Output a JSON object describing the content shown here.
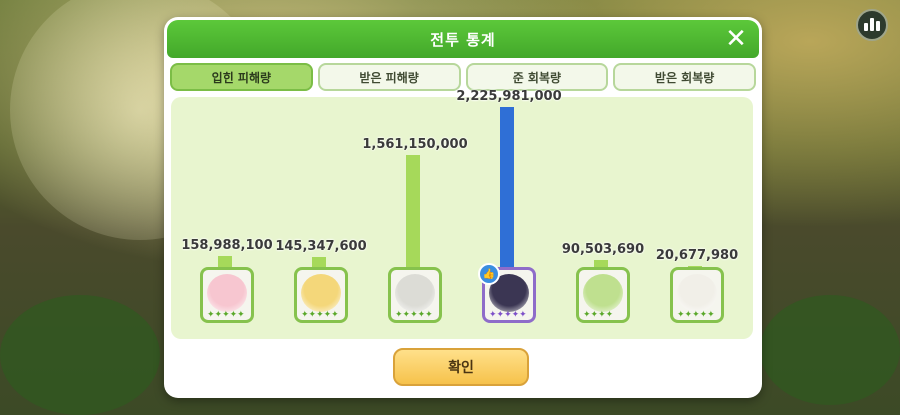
{
  "modal": {
    "title": "전투 통계",
    "close_glyph": "✕",
    "confirm_label": "확인"
  },
  "tabs": [
    {
      "label": "입힌 피해량",
      "active": true
    },
    {
      "label": "받은 피해량",
      "active": false
    },
    {
      "label": "준 회복량",
      "active": false
    },
    {
      "label": "받은 회복량",
      "active": false
    }
  ],
  "chart_data": {
    "type": "bar",
    "categories": [
      "",
      "",
      "",
      "",
      "",
      ""
    ],
    "values": [
      158988100,
      145347600,
      1561150000,
      2225981000,
      90503690,
      20677980
    ],
    "value_labels": [
      "158,988,100",
      "145,347,600",
      "1,561,150,000",
      "2,225,981,000",
      "90,503,690",
      "20,677,980"
    ],
    "bar_colors": [
      "#a6d95a",
      "#a6d95a",
      "#a6d95a",
      "#2f6fd6",
      "#a6d95a",
      "#a6d95a"
    ],
    "ylim": [
      0,
      2225981000
    ]
  },
  "characters": [
    {
      "icon": "pink-haired-character-portrait",
      "rarity": "green",
      "stars": "✦✦✦✦✦"
    },
    {
      "icon": "blonde-character-portrait",
      "rarity": "green",
      "stars": "✦✦✦✦✦"
    },
    {
      "icon": "white-haired-character-portrait",
      "rarity": "green",
      "stars": "✦✦✦✦✦"
    },
    {
      "icon": "dark-hooded-character-portrait",
      "rarity": "purple",
      "stars": "✦✦✦✦✦",
      "badge_icon": "thumbs-up-icon"
    },
    {
      "icon": "green-haired-character-portrait",
      "rarity": "green",
      "stars": "✦✦✦✦"
    },
    {
      "icon": "white-flower-character-portrait",
      "rarity": "green",
      "stars": "✦✦✦✦✦"
    }
  ],
  "colors": {
    "header_green": "#4fb833",
    "active_tab": "#a5d86a",
    "panel": "#e8f5cf",
    "highlight_bar": "#2f6fd6",
    "normal_bar": "#a6d95a",
    "confirm_button": "#f6c24b"
  },
  "top_right": {
    "icon": "bar-chart-icon"
  }
}
